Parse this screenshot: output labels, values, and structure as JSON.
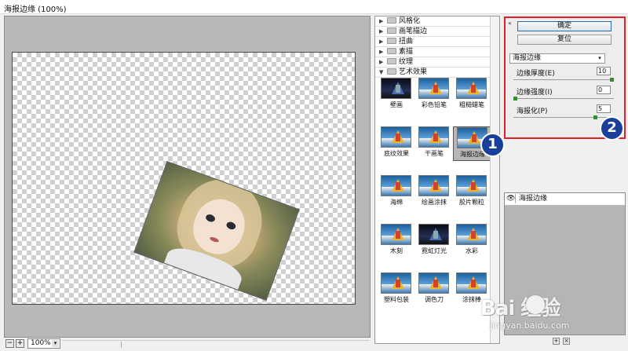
{
  "window": {
    "title": "海报边缘 (100%)"
  },
  "zoom": {
    "minus": "−",
    "plus": "+",
    "value": "100%",
    "dropdown": "▾"
  },
  "categories": [
    {
      "arrow": "▶",
      "label": "风格化"
    },
    {
      "arrow": "▶",
      "label": "画笔描边"
    },
    {
      "arrow": "▶",
      "label": "扭曲"
    },
    {
      "arrow": "▶",
      "label": "素描"
    },
    {
      "arrow": "▶",
      "label": "纹理"
    },
    {
      "arrow": "▼",
      "label": "艺术效果"
    }
  ],
  "thumbnails": [
    {
      "label": "壁画",
      "style": "dark"
    },
    {
      "label": "彩色铅笔",
      "style": "sea"
    },
    {
      "label": "粗糙蜡笔",
      "style": "sea"
    },
    {
      "label": "底纹效果",
      "style": "sea"
    },
    {
      "label": "干画笔",
      "style": "sea"
    },
    {
      "label": "海报边缘",
      "style": "sea",
      "selected": true
    },
    {
      "label": "海绵",
      "style": "sea"
    },
    {
      "label": "绘画涂抹",
      "style": "sea"
    },
    {
      "label": "胶片颗粒",
      "style": "sea"
    },
    {
      "label": "木刻",
      "style": "sea"
    },
    {
      "label": "霓虹灯光",
      "style": "dark"
    },
    {
      "label": "水彩",
      "style": "sea"
    },
    {
      "label": "塑料包装",
      "style": "sea"
    },
    {
      "label": "调色刀",
      "style": "sea"
    },
    {
      "label": "涂抹棒",
      "style": "sea"
    }
  ],
  "settings": {
    "collapse": "«",
    "ok_label": "确定",
    "reset_label": "复位",
    "filter_name": "海报边缘",
    "dropdown": "▾",
    "params": [
      {
        "label": "边缘厚度(E)",
        "value": "10",
        "level": 1.0
      },
      {
        "label": "边缘强度(I)",
        "value": "0",
        "level": 0.0
      },
      {
        "label": "海报化(P)",
        "value": "5",
        "level": 0.83
      }
    ]
  },
  "badges": {
    "one": "1",
    "two": "2"
  },
  "effects": {
    "eye": "👁",
    "layer_label": "海报边缘",
    "new": "+",
    "delete": "×"
  },
  "watermark": {
    "brand": "Bai 经验",
    "url": "jingyan.baidu.com"
  }
}
